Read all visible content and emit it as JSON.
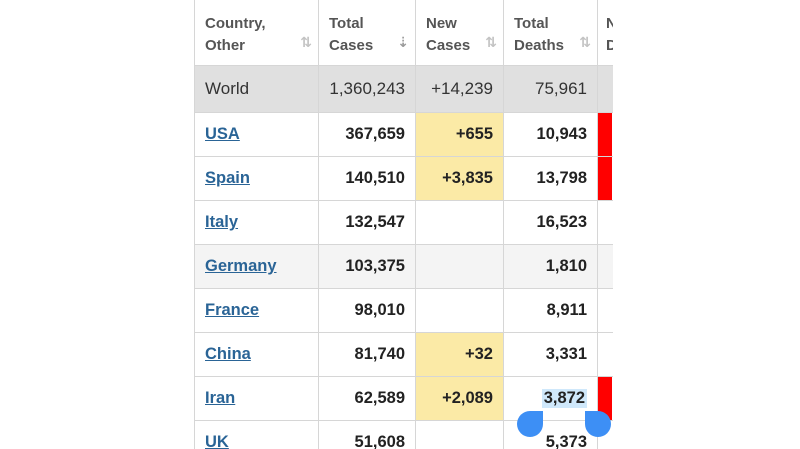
{
  "headers": [
    {
      "label": "Country,\nOther",
      "sort": "⇅",
      "active": false
    },
    {
      "label": "Total\nCases",
      "sort": "⇣",
      "active": true
    },
    {
      "label": "New\nCases",
      "sort": "⇅",
      "active": false
    },
    {
      "label": "Total\nDeaths",
      "sort": "⇅",
      "active": false
    },
    {
      "label": "N\nD"
    }
  ],
  "world": {
    "name": "World",
    "total_cases": "1,360,243",
    "new_cases": "+14,239",
    "total_deaths": "75,961"
  },
  "rows": [
    {
      "country": "USA",
      "total_cases": "367,659",
      "new_cases": "+655",
      "total_deaths": "10,943",
      "new_deaths_bar": true
    },
    {
      "country": "Spain",
      "total_cases": "140,510",
      "new_cases": "+3,835",
      "total_deaths": "13,798",
      "new_deaths_bar": true
    },
    {
      "country": "Italy",
      "total_cases": "132,547",
      "new_cases": "",
      "total_deaths": "16,523",
      "new_deaths_bar": false
    },
    {
      "country": "Germany",
      "total_cases": "103,375",
      "new_cases": "",
      "total_deaths": "1,810",
      "new_deaths_bar": false
    },
    {
      "country": "France",
      "total_cases": "98,010",
      "new_cases": "",
      "total_deaths": "8,911",
      "new_deaths_bar": false
    },
    {
      "country": "China",
      "total_cases": "81,740",
      "new_cases": "+32",
      "total_deaths": "3,331",
      "new_deaths_bar": false
    },
    {
      "country": "Iran",
      "total_cases": "62,589",
      "new_cases": "+2,089",
      "total_deaths": "3,872",
      "new_deaths_bar": true,
      "selected": true
    },
    {
      "country": "UK",
      "total_cases": "51,608",
      "new_cases": "",
      "total_deaths": "5,373",
      "new_deaths_bar": false
    }
  ],
  "colors": {
    "link": "#2a6496",
    "new_cases_highlight": "#fbeaa6",
    "new_deaths_highlight": "#ff0000",
    "world_row": "#e0e0e0",
    "selection": "#cfe8fb",
    "handle": "#3d8ff5"
  }
}
